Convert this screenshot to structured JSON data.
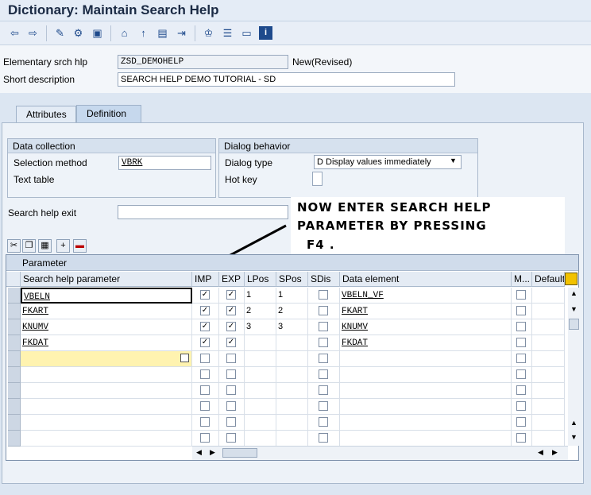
{
  "window": {
    "title": "Dictionary: Maintain Search Help"
  },
  "toolbar": {
    "icons": [
      "back-icon",
      "forward-icon",
      "edit-icon",
      "activate-icon",
      "where-used-icon",
      "object-list-icon",
      "other-object-icon",
      "display-icon",
      "navigate-icon",
      "hierarchy-icon",
      "stack-icon",
      "layout-icon",
      "info-icon"
    ]
  },
  "header": {
    "elem_label": "Elementary srch hlp",
    "elem_value": "ZSD_DEMOHELP",
    "status": "New(Revised)",
    "desc_label": "Short description",
    "desc_value": "SEARCH HELP DEMO TUTORIAL - SD"
  },
  "tabs": [
    {
      "label": "Attributes"
    },
    {
      "label": "Definition"
    }
  ],
  "data_collection": {
    "heading": "Data collection",
    "method_label": "Selection method",
    "method_value": "VBRK",
    "text_table_label": "Text table"
  },
  "dialog": {
    "heading": "Dialog behavior",
    "type_label": "Dialog type",
    "type_value": "D Display values immediately",
    "hotkey_label": "Hot key"
  },
  "exit": {
    "label": "Search help exit"
  },
  "annotation": {
    "line1": "NOW ENTER SEARCH HELP",
    "line2": "PARAMETER BY PRESSING",
    "line3": "F4 ."
  },
  "table": {
    "title": "Parameter",
    "columns": [
      "Search help parameter",
      "IMP",
      "EXP",
      "LPos",
      "SPos",
      "SDis",
      "Data element",
      "M...",
      "Default"
    ],
    "rows": [
      {
        "param": "VBELN",
        "imp": true,
        "exp": true,
        "lpos": "1",
        "spos": "1",
        "sdis": false,
        "elem": "VBELN_VF",
        "m": false
      },
      {
        "param": "FKART",
        "imp": true,
        "exp": true,
        "lpos": "2",
        "spos": "2",
        "sdis": false,
        "elem": "FKART",
        "m": false
      },
      {
        "param": "KNUMV",
        "imp": true,
        "exp": true,
        "lpos": "3",
        "spos": "3",
        "sdis": false,
        "elem": "KNUMV",
        "m": false
      },
      {
        "param": "FKDAT",
        "imp": true,
        "exp": true,
        "lpos": "",
        "spos": "",
        "sdis": false,
        "elem": "FKDAT",
        "m": false
      }
    ]
  }
}
